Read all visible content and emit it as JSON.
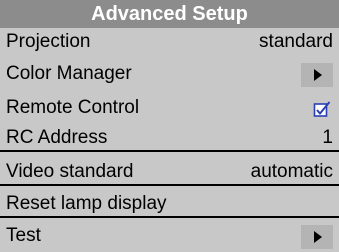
{
  "menu": {
    "title": "Advanced Setup",
    "items": [
      {
        "label": "Projection",
        "value": "standard",
        "control": "value"
      },
      {
        "label": "Color Manager",
        "control": "submenu-arrow"
      },
      {
        "label": "Remote Control",
        "control": "checkbox",
        "checked": true
      },
      {
        "label": "RC Address",
        "value": "1",
        "control": "value"
      },
      {
        "label": "Video standard",
        "value": "automatic",
        "control": "value"
      },
      {
        "label": "Reset lamp display",
        "value": "",
        "control": "action"
      },
      {
        "label": "Test",
        "control": "submenu-arrow"
      }
    ]
  },
  "colors": {
    "title_bg": "#8c8c8c",
    "menu_bg": "#c8c8c8",
    "arrow_bg": "#b4b4b4",
    "check_color": "#2a3fb5"
  },
  "icons": {
    "submenu": "triangle-right-icon",
    "checkbox": "checkbox-checked-icon"
  }
}
